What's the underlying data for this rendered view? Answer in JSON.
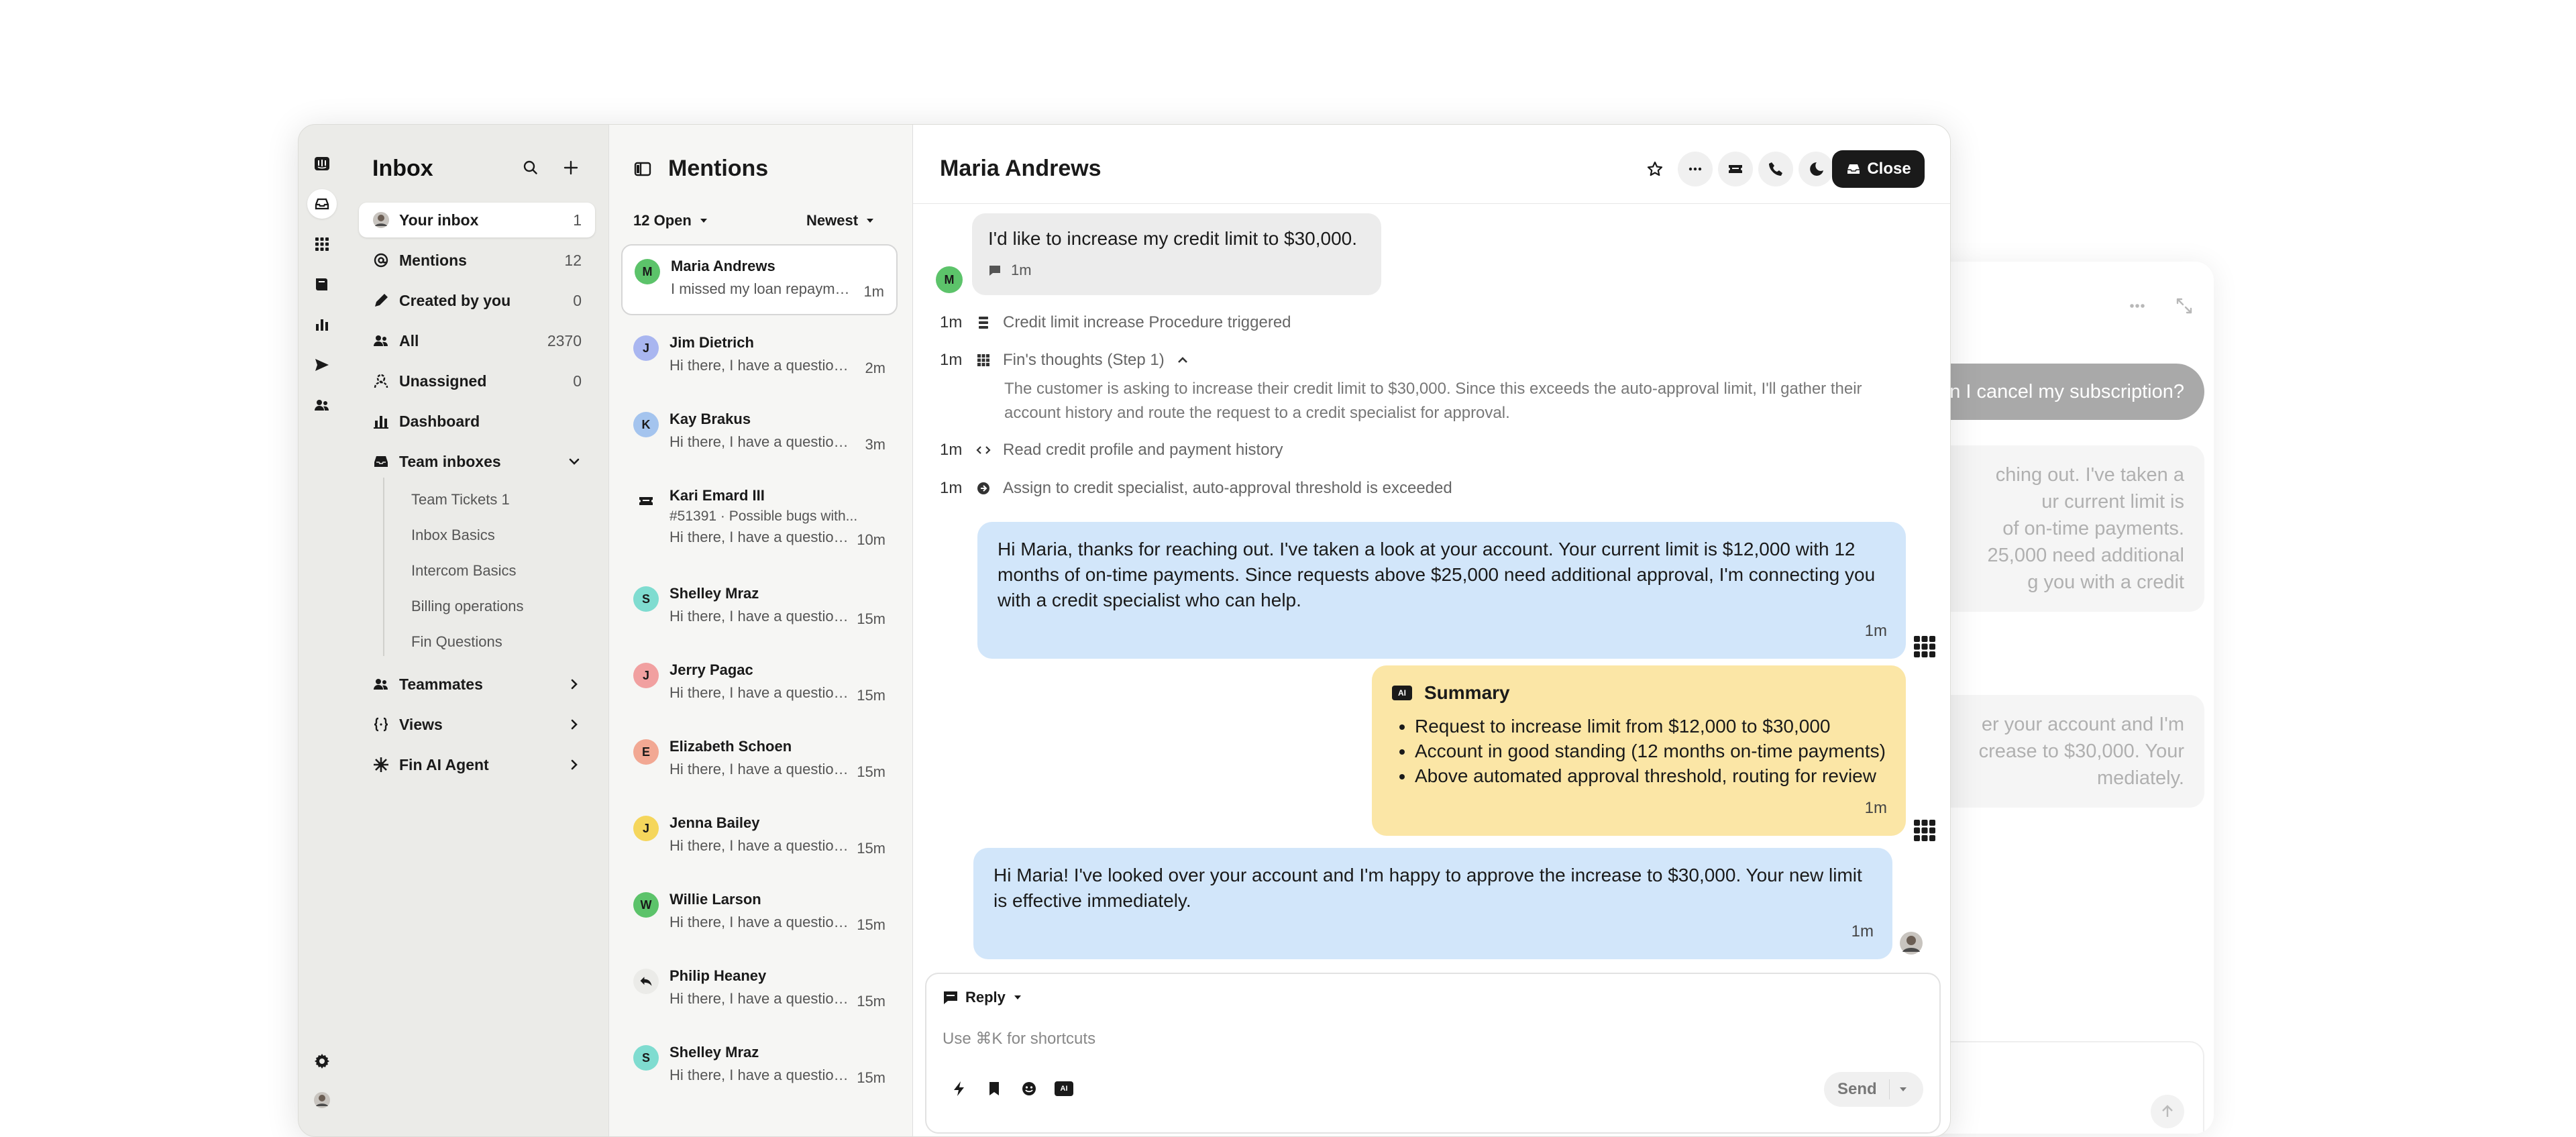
{
  "ghost": {
    "user_message": "n I cancel my subscription?",
    "card1_lines": [
      "ching out. I've taken a",
      "ur current limit is",
      "of on-time payments.",
      "25,000 need additional",
      "g you with a credit"
    ],
    "card2_lines": [
      "er your account and I'm",
      "crease to $30,000. Your",
      "mediately."
    ]
  },
  "nav": {
    "title": "Inbox",
    "items": [
      {
        "label": "Your inbox",
        "count": "1"
      },
      {
        "label": "Mentions",
        "count": "12"
      },
      {
        "label": "Created by you",
        "count": "0"
      },
      {
        "label": "All",
        "count": "2370"
      },
      {
        "label": "Unassigned",
        "count": "0"
      },
      {
        "label": "Dashboard",
        "count": ""
      },
      {
        "label": "Team inboxes",
        "count": ""
      },
      {
        "label": "Teammates",
        "count": ""
      },
      {
        "label": "Views",
        "count": ""
      },
      {
        "label": "Fin AI Agent",
        "count": ""
      }
    ],
    "team_inboxes": [
      "Team Tickets 1",
      "Inbox Basics",
      "Intercom Basics",
      "Billing operations",
      "Fin Questions"
    ]
  },
  "list": {
    "title": "Mentions",
    "filter_status": "12 Open",
    "filter_sort": "Newest",
    "conversations": [
      {
        "initial": "M",
        "name": "Maria Andrews",
        "preview": "I missed my loan repayment",
        "time": "1m",
        "color": "#5cc36a"
      },
      {
        "initial": "J",
        "name": "Jim Dietrich",
        "preview": "Hi there, I have a question about",
        "time": "2m",
        "color": "#a9b6f0"
      },
      {
        "initial": "K",
        "name": "Kay Brakus",
        "preview": "Hi there, I have a question about",
        "time": "3m",
        "color": "#a4c4ee"
      },
      {
        "initial": "",
        "name": "Kari Emard III",
        "sub": "#51391 · Possible bugs with...",
        "preview": "Hi there, I have a question about",
        "time": "10m",
        "color": ""
      },
      {
        "initial": "S",
        "name": "Shelley Mraz",
        "preview": "Hi there, I have a question about",
        "time": "15m",
        "color": "#7fdcd0"
      },
      {
        "initial": "J",
        "name": "Jerry Pagac",
        "preview": "Hi there, I have a question about",
        "time": "15m",
        "color": "#f1a0a0"
      },
      {
        "initial": "E",
        "name": "Elizabeth Schoen",
        "preview": "Hi there, I have a question about",
        "time": "15m",
        "color": "#f2a893"
      },
      {
        "initial": "J",
        "name": "Jenna Bailey",
        "preview": "Hi there, I have a question about",
        "time": "15m",
        "color": "#f5d65c"
      },
      {
        "initial": "W",
        "name": "Willie Larson",
        "preview": "Hi there, I have a question about",
        "time": "15m",
        "color": "#5cc36a"
      },
      {
        "initial": "",
        "name": "Philip Heaney",
        "preview": "Hi there, I have a question about",
        "time": "15m",
        "color": ""
      },
      {
        "initial": "S",
        "name": "Shelley Mraz",
        "preview": "Hi there, I have a question about",
        "time": "15m",
        "color": "#7fdcd0"
      }
    ]
  },
  "conversation": {
    "title": "Maria Andrews",
    "close_label": "Close",
    "customer_initial": "M",
    "customer_message": "I'd like to increase my credit limit to $30,000.",
    "customer_time": "1m",
    "events": [
      {
        "time": "1m",
        "text": "Credit limit increase Procedure triggered"
      },
      {
        "time": "1m",
        "text": "Fin's thoughts (Step 1)"
      },
      {
        "time": "1m",
        "text": "Read credit profile and payment history"
      },
      {
        "time": "1m",
        "text": "Assign to credit specialist, auto-approval threshold is exceeded"
      }
    ],
    "thought_text": "The customer is asking to increase their credit limit to $30,000. Since this exceeds the auto-approval limit, I'll gather their account history and route the request to a credit specialist for approval.",
    "fin_reply": "Hi Maria, thanks for reaching out. I've taken a look at your account. Your current limit is $12,000 with 12 months of on-time payments. Since requests above $25,000 need additional approval, I'm connecting you with a credit specialist who can help.",
    "fin_reply_time": "1m",
    "summary": {
      "badge": "AI",
      "title": "Summary",
      "items": [
        "Request to increase limit from $12,000 to $30,000",
        "Account in good standing (12 months on-time payments)",
        "Above automated approval threshold, routing for review"
      ],
      "time": "1m"
    },
    "agent_reply": "Hi Maria! I've looked over your account and I'm happy to approve the increase to $30,000. Your new limit is effective immediately.",
    "agent_reply_time": "1m"
  },
  "composer": {
    "mode": "Reply",
    "placeholder": "Use ⌘K for shortcuts",
    "ai_badge": "AI",
    "send_label": "Send"
  }
}
